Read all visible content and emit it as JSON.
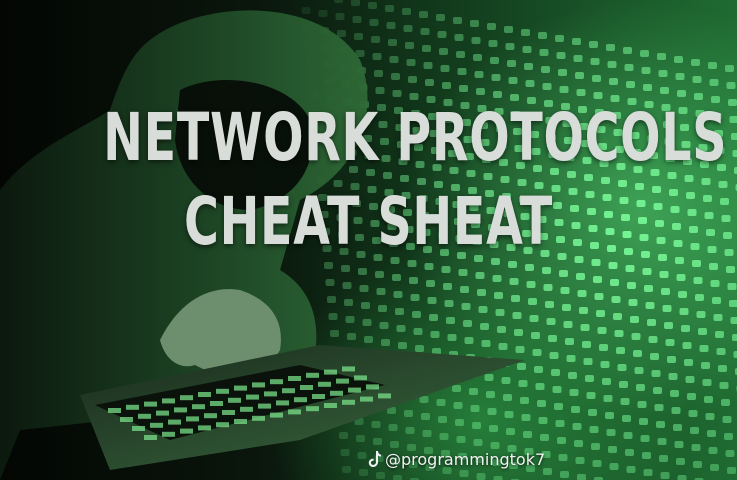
{
  "image": {
    "description_colors": {
      "glow": "#3fe06a",
      "dark": "#050a05",
      "title_text": "#d9ddd9"
    }
  },
  "title": {
    "line1": "NETWORK PROTOCOLS",
    "line2": "CHEAT SHEAT"
  },
  "watermark": {
    "icon": "tiktok-icon",
    "handle": "@programmingtok7"
  }
}
